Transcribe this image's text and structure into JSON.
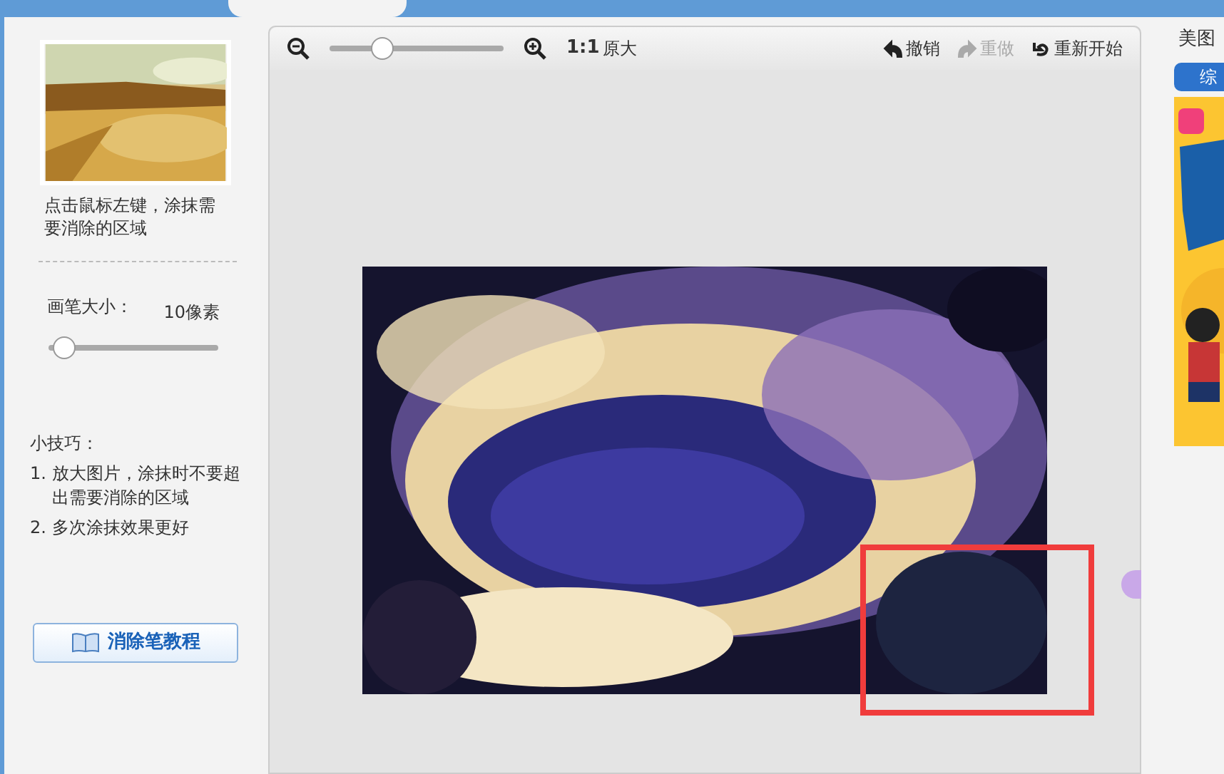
{
  "left": {
    "hint": "点击鼠标左键，涂抹需要消除的区域",
    "brush": {
      "label": "画笔大小：",
      "reading": "10像素",
      "level": 0.09
    },
    "tips": {
      "title": "小技巧：",
      "items": [
        {
          "number": "1.",
          "text": "放大图片，涂抹时不要超出需要消除的区域"
        },
        {
          "number": "2.",
          "text": "多次涂抹效果更好"
        }
      ]
    },
    "tutorial_button": "消除笔教程"
  },
  "toolbar": {
    "zoom": {
      "level": 0.3
    },
    "actual_size": {
      "ratio": "1:1",
      "label": "原大"
    },
    "actions": [
      {
        "kind": "undo",
        "label": "撤销",
        "disabled": false
      },
      {
        "kind": "redo",
        "label": "重做",
        "disabled": true
      },
      {
        "kind": "restart",
        "label": "重新开始",
        "disabled": false
      }
    ]
  },
  "right": {
    "title": "美图",
    "tab": "综"
  }
}
